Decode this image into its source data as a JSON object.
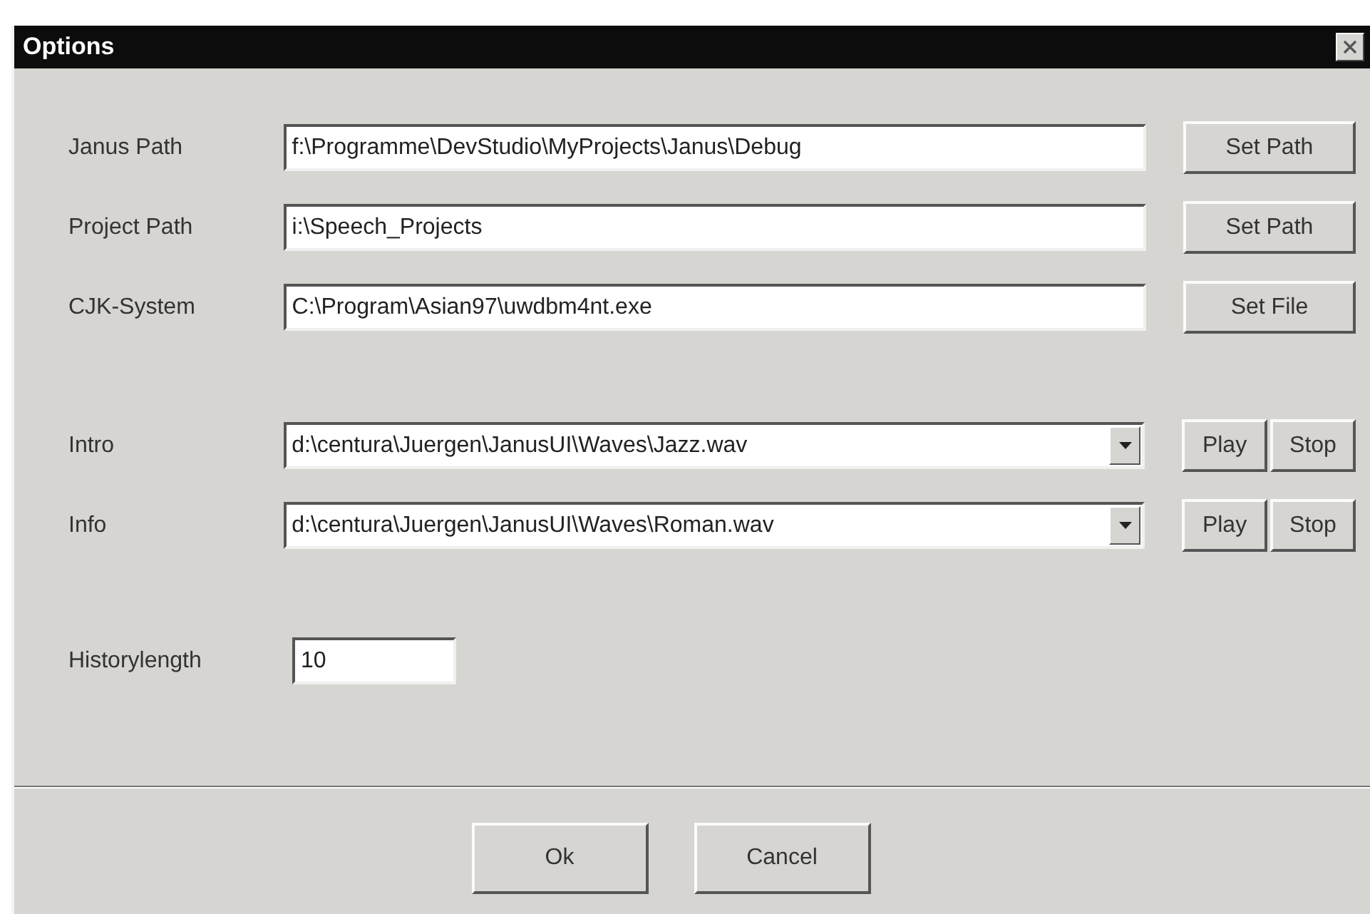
{
  "window": {
    "title": "Options"
  },
  "paths": [
    {
      "label": "Janus Path",
      "value": "f:\\Programme\\DevStudio\\MyProjects\\Janus\\Debug",
      "button": "Set Path"
    },
    {
      "label": "Project Path",
      "value": "i:\\Speech_Projects",
      "button": "Set Path"
    },
    {
      "label": "CJK-System",
      "value": "C:\\Program\\Asian97\\uwdbm4nt.exe",
      "button": "Set File"
    }
  ],
  "sounds": [
    {
      "label": "Intro",
      "value": "d:\\centura\\Juergen\\JanusUI\\Waves\\Jazz.wav",
      "buttons": [
        "Play",
        "Stop"
      ]
    },
    {
      "label": "Info",
      "value": "d:\\centura\\Juergen\\JanusUI\\Waves\\Roman.wav",
      "buttons": [
        "Play",
        "Stop"
      ]
    }
  ],
  "history": {
    "label": "Historylength",
    "value": "10"
  },
  "buttons": [
    "Ok",
    "Cancel"
  ]
}
